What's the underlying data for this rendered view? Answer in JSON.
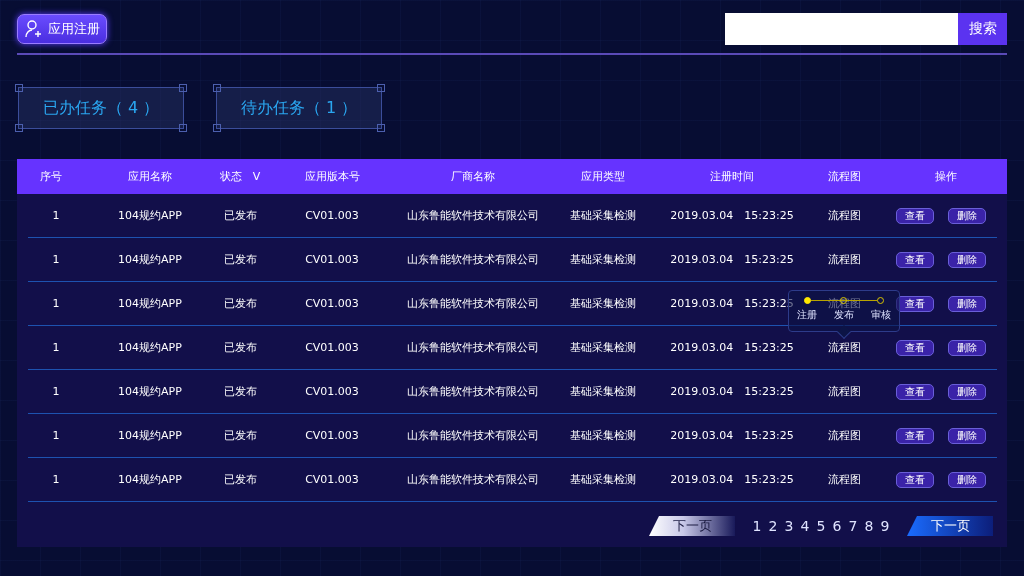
{
  "header": {
    "register_button": "应用注册",
    "search": {
      "button": "搜索"
    }
  },
  "task_tabs": [
    {
      "label": "已办任务（ 4 ）"
    },
    {
      "label": "待办任务（ 1 ）"
    }
  ],
  "table": {
    "columns": [
      "序号",
      "应用名称",
      "状态　V",
      "应用版本号",
      "厂商名称",
      "应用类型",
      "注册时间",
      "流程图",
      "操作"
    ],
    "rows": [
      {
        "cells": [
          "1",
          "104规约APP",
          "已发布",
          "CV01.003",
          "山东鲁能软件技术有限公司",
          "基础采集检测",
          "2019.03.04　15:23:25",
          "流程图"
        ],
        "actions": [
          "查看",
          "删除"
        ]
      },
      {
        "cells": [
          "1",
          "104规约APP",
          "已发布",
          "CV01.003",
          "山东鲁能软件技术有限公司",
          "基础采集检测",
          "2019.03.04　15:23:25",
          "流程图"
        ],
        "actions": [
          "查看",
          "删除"
        ]
      },
      {
        "cells": [
          "1",
          "104规约APP",
          "已发布",
          "CV01.003",
          "山东鲁能软件技术有限公司",
          "基础采集检测",
          "2019.03.04　15:23:25",
          "流程图"
        ],
        "actions": [
          "查看",
          "删除"
        ]
      },
      {
        "cells": [
          "1",
          "104规约APP",
          "已发布",
          "CV01.003",
          "山东鲁能软件技术有限公司",
          "基础采集检测",
          "2019.03.04　15:23:25",
          "流程图"
        ],
        "actions": [
          "查看",
          "删除"
        ]
      },
      {
        "cells": [
          "1",
          "104规约APP",
          "已发布",
          "CV01.003",
          "山东鲁能软件技术有限公司",
          "基础采集检测",
          "2019.03.04　15:23:25",
          "流程图"
        ],
        "actions": [
          "查看",
          "删除"
        ]
      },
      {
        "cells": [
          "1",
          "104规约APP",
          "已发布",
          "CV01.003",
          "山东鲁能软件技术有限公司",
          "基础采集检测",
          "2019.03.04　15:23:25",
          "流程图"
        ],
        "actions": [
          "查看",
          "删除"
        ]
      },
      {
        "cells": [
          "1",
          "104规约APP",
          "已发布",
          "CV01.003",
          "山东鲁能软件技术有限公司",
          "基础采集检测",
          "2019.03.04　15:23:25",
          "流程图"
        ],
        "actions": [
          "查看",
          "删除"
        ]
      }
    ],
    "flow_popup": {
      "steps": [
        {
          "label": "注册",
          "done": true
        },
        {
          "label": "发布",
          "done": false
        },
        {
          "label": "审核",
          "done": false
        }
      ]
    }
  },
  "pager": {
    "buttons": [
      {
        "label": "下一页",
        "kind": "light"
      },
      {
        "label": "下一页",
        "kind": "blue"
      }
    ],
    "pages": [
      "1",
      "2",
      "3",
      "4",
      "5",
      "6",
      "7",
      "8",
      "9"
    ]
  }
}
